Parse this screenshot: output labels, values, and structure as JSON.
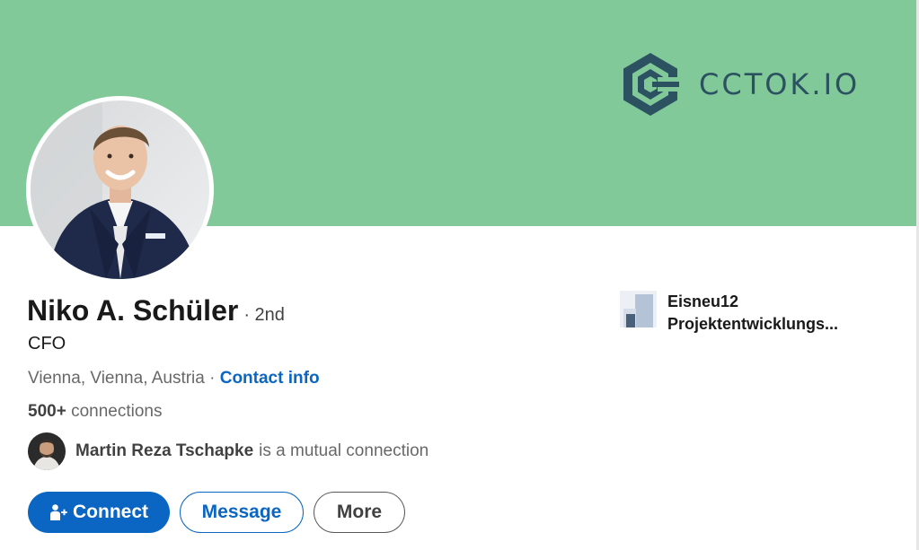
{
  "banner": {
    "brand_name": "CCTOK.IO",
    "brand_icon": "cctok-hexagon-logo",
    "background_color": "#82c99a",
    "brand_color": "#2c5261"
  },
  "profile": {
    "name": "Niko A. Schüler",
    "degree": "· 2nd",
    "headline": "CFO",
    "location": "Vienna, Vienna, Austria",
    "separator": " · ",
    "contact_info_label": "Contact info",
    "connections_count": "500+",
    "connections_label": " connections",
    "mutual_name": "Martin Reza Tschapke",
    "mutual_suffix": "is a mutual connection"
  },
  "actions": {
    "connect_label": "Connect",
    "message_label": "Message",
    "more_label": "More",
    "accent_color": "#0a66c2"
  },
  "company": {
    "line1": "Eisneu12",
    "line2": "Projektentwicklungs..."
  }
}
